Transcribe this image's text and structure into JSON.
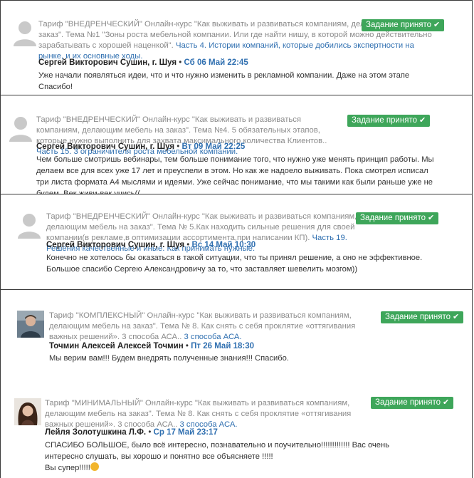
{
  "badge_label": "Задание принято",
  "entries": [
    {
      "meta": "Тариф \"ВНЕДРЕНЧЕСКИЙ\" Онлайн-курс \"Как выживать и развиваться компаниям, делающим мебель на заказ\". Тема №1 \"Зоны роста мебельной компании. Или где найти нишу, в которой можно действительно зарабатывать с хорошей наценкой\".",
      "link": "Часть 4. Истории компаний, которые добились экспертности на рынке, и их основные ходы.",
      "author": "Сергей Викторович Сушин, г. Шуя",
      "date": "Сб 06 Май 22:45",
      "text": "Уже начали появляться идеи, что и что нужно изменить в рекламной компании. Даже на этом этапе Спасибо!"
    },
    {
      "meta": "Тариф \"ВНЕДРЕНЧЕСКИЙ\" Онлайн-курс \"Как выживать и развиваться компаниям, делающим мебель на заказ\". Тема №4. 5 обязательных этапов, которые нужно выполнить для захвата максимального количества Клиентов..",
      "link": "Часть 15. 3 ограничителя роста мебельной компании.",
      "author": "Сергей Викторович Сушин, г. Шуя",
      "date": "Вт 09 Май 22:25",
      "text": "Чем больше смотришь вебинары, тем больше понимание того, что нужно уже менять принцип работы. Мы делаем все для всех уже 17 лет и преуспели в этом. Но как же надоело выживать. Пока смотрел исписал три листа формата А4 мыслями и идеями. Уже сейчас понимание, что мы такими как были раньше уже не будем. Век живи-век учись(("
    },
    {
      "meta": "Тариф \"ВНЕДРЕНЧЕСКИЙ\" Онлайн-курс \"Как выживать и развиваться компаниям, делающим мебель на заказ\". Тема № 5.Как находить сильные решения для своей компании(в рекламе,в оптимизации ассортимента,при написании КП).",
      "link": "Часть 19. Решения качественные и иные. Как принимать нужные.",
      "author": "Сергей Викторович Сушин, г. Шуя",
      "date": "Вс 14 Май 10:30",
      "text": "Конечно не хотелось бы оказаться в такой ситуации, что ты принял решение, а оно не эффективное. Большое спасибо Сергею Александровичу за то, что заставляет шевелить мозгом))"
    },
    {
      "meta": "Тариф \"КОМПЛЕКСНЫЙ\" Онлайн-курс \"Как выживать и развиваться компаниям, делающим мебель на заказ\". Тема № 8. Как снять с себя проклятие «оттягивания важных решений». 3 способа АСА..",
      "link": "3 способа АСА.",
      "author": "Точмин Алексей Алексей Точмин",
      "date": "Пт 26 Май 18:30",
      "text": "Мы верим вам!!! Будем внедрять полученные знания!!! Спасибо."
    },
    {
      "meta": "Тариф \"МИНИМАЛЬНЫЙ\" Онлайн-курс \"Как выживать и развиваться компаниям, делающим мебель на заказ\". Тема № 8. Как снять с себя проклятие «оттягивания важных решений». 3 способа АСА..",
      "link": "3 способа АСА.",
      "author": "Лейля Золотушкина Л.Ф.",
      "date": "Ср 17 Май 23:17",
      "text": "СПАСИБО БОЛЬШОЕ, было всё интересно, познавательно и поучительно!!!!!!!!!!!!! Вас очень интересно слушать, вы хорошо и понятно все объясняете !!!!!",
      "text2": "Вы супер!!!!!"
    }
  ]
}
